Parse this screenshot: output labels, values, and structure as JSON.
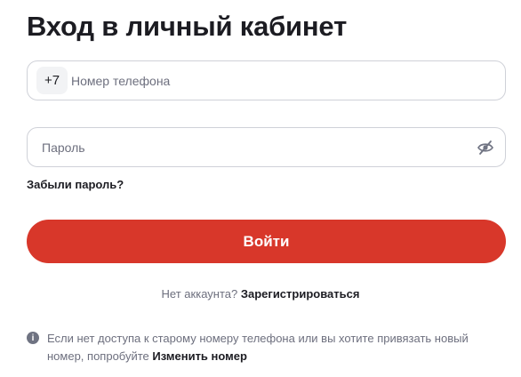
{
  "page": {
    "title": "Вход в личный кабинет"
  },
  "phone": {
    "prefix": "+7",
    "placeholder": "Номер телефона",
    "value": ""
  },
  "password": {
    "placeholder": "Пароль",
    "value": "",
    "toggle_icon": "eye-slash-icon"
  },
  "forgot_password": {
    "label": "Забыли пароль?"
  },
  "login": {
    "label": "Войти",
    "color": "#d8372a"
  },
  "signup": {
    "prompt": "Нет аккаунта?",
    "link": "Зарегистрироваться"
  },
  "info": {
    "icon": "info-icon",
    "icon_glyph": "i",
    "text": "Если нет доступа к старому номеру телефона или вы хотите привязать новый номер, попробуйте",
    "link": "Изменить номер"
  }
}
